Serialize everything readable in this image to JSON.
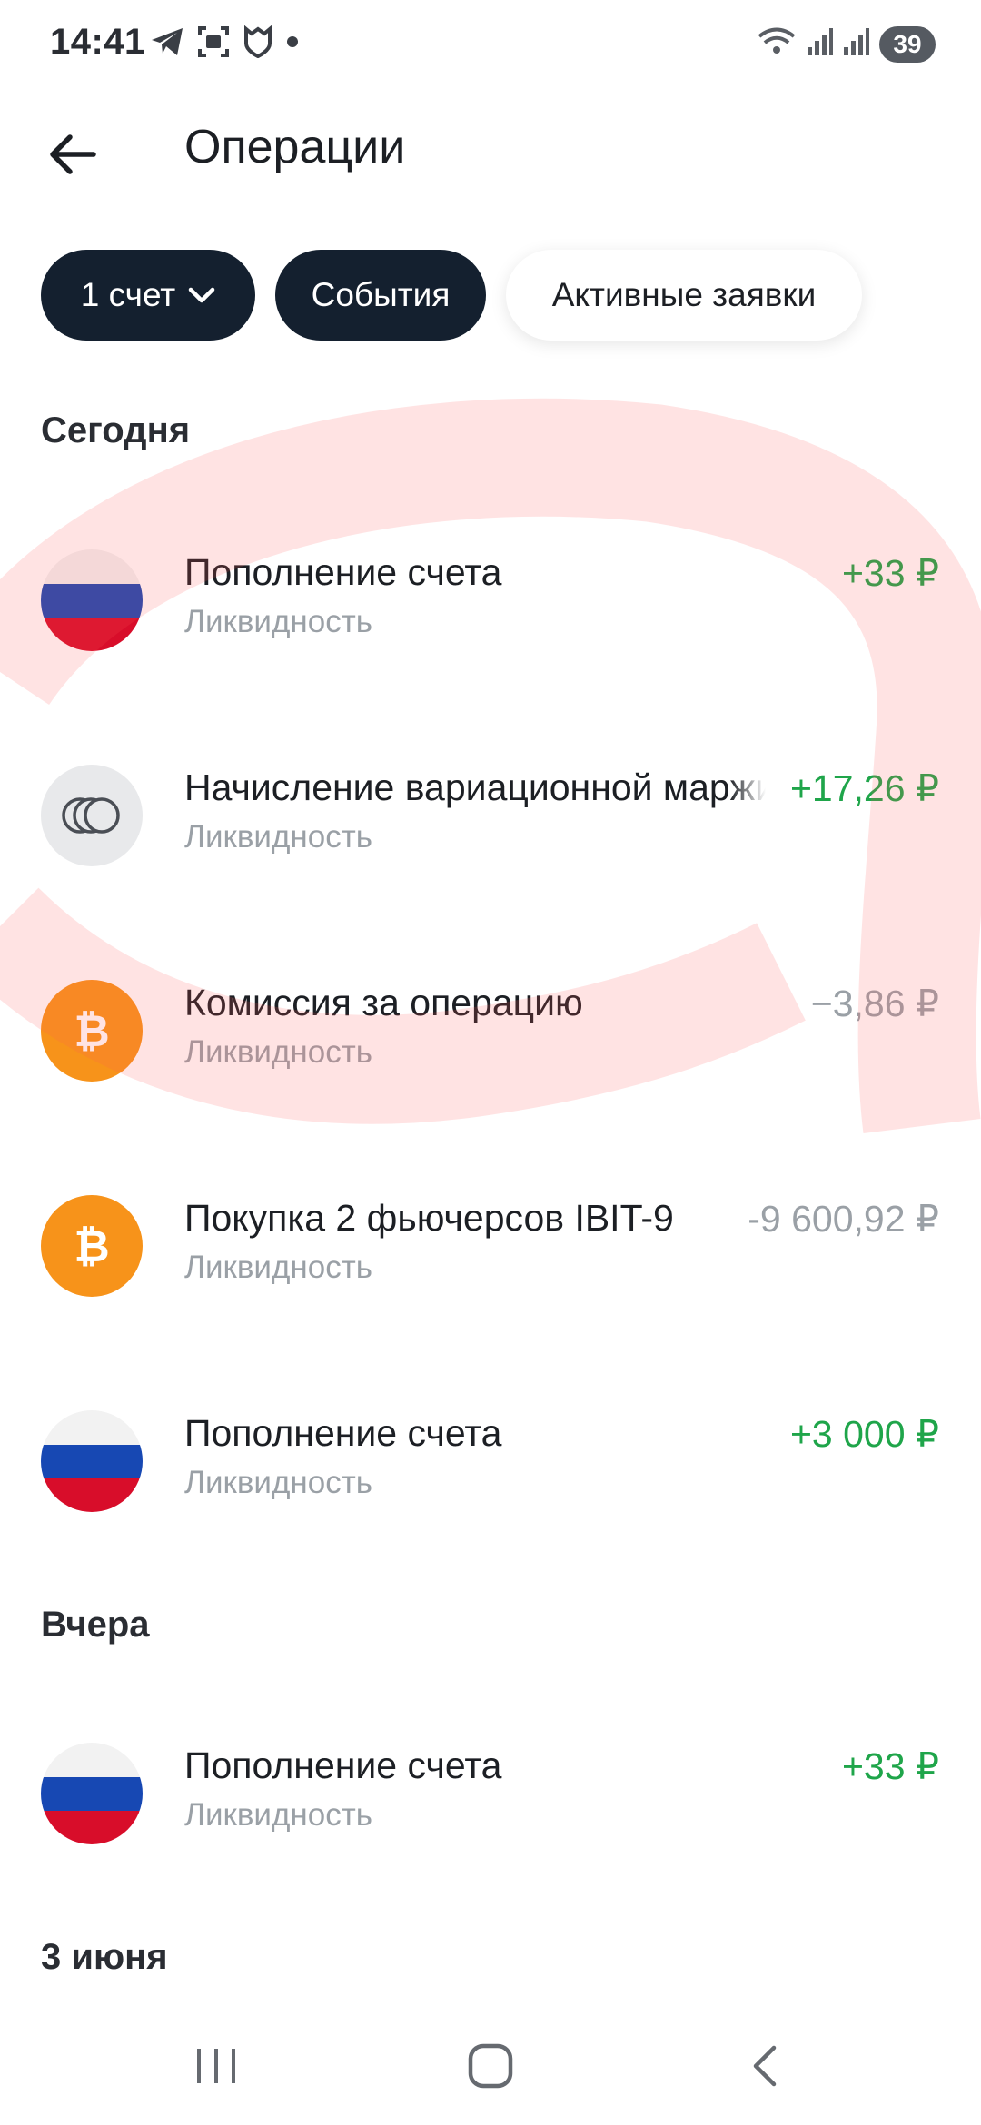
{
  "status_bar": {
    "time": "14:41",
    "battery": "39",
    "icons_left": [
      "telegram-icon",
      "screen-capture-icon",
      "mi-shield-icon",
      "notification-dot-icon"
    ],
    "icons_right": [
      "wifi-icon",
      "signal-icon",
      "signal-icon"
    ]
  },
  "header": {
    "title": "Операции",
    "back_icon": "arrow-left-icon"
  },
  "filters": {
    "accounts_label": "1 счет",
    "events_label": "События",
    "orders_label": "Активные заявки"
  },
  "sections": {
    "today": "Сегодня",
    "yesterday": "Вчера",
    "june3": "3 июня"
  },
  "operations": [
    {
      "title": "Пополнение счета",
      "subtitle": "Ликвидность",
      "amount": "+33 ₽",
      "icon": "russia-flag-icon",
      "type": "positive"
    },
    {
      "title": "Начисление вариационной маржи",
      "subtitle": "Ликвидность",
      "amount": "+17,26 ₽",
      "icon": "coins-icon",
      "type": "positive"
    },
    {
      "title": "Комиссия за операцию",
      "subtitle": "Ликвидность",
      "amount": "−3,86 ₽",
      "icon": "bitcoin-icon",
      "type": "negative"
    },
    {
      "title": "Покупка 2 фьючерсов IBIT-9",
      "subtitle": "Ликвидность",
      "amount": "-9 600,92 ₽",
      "icon": "bitcoin-icon",
      "type": "negative"
    },
    {
      "title": "Пополнение счета",
      "subtitle": "Ликвидность",
      "amount": "+3 000 ₽",
      "icon": "russia-flag-icon",
      "type": "positive"
    },
    {
      "title": "Пополнение счета",
      "subtitle": "Ликвидность",
      "amount": "+33 ₽",
      "icon": "russia-flag-icon",
      "type": "positive"
    }
  ],
  "nav": {
    "recent_icon": "recent-apps-icon",
    "home_icon": "home-icon",
    "back_icon": "back-icon"
  },
  "colors": {
    "positive": "#1fa54a",
    "negative": "#9aa0a6",
    "chip_dark": "#14202f",
    "bitcoin": "#f7931a"
  }
}
